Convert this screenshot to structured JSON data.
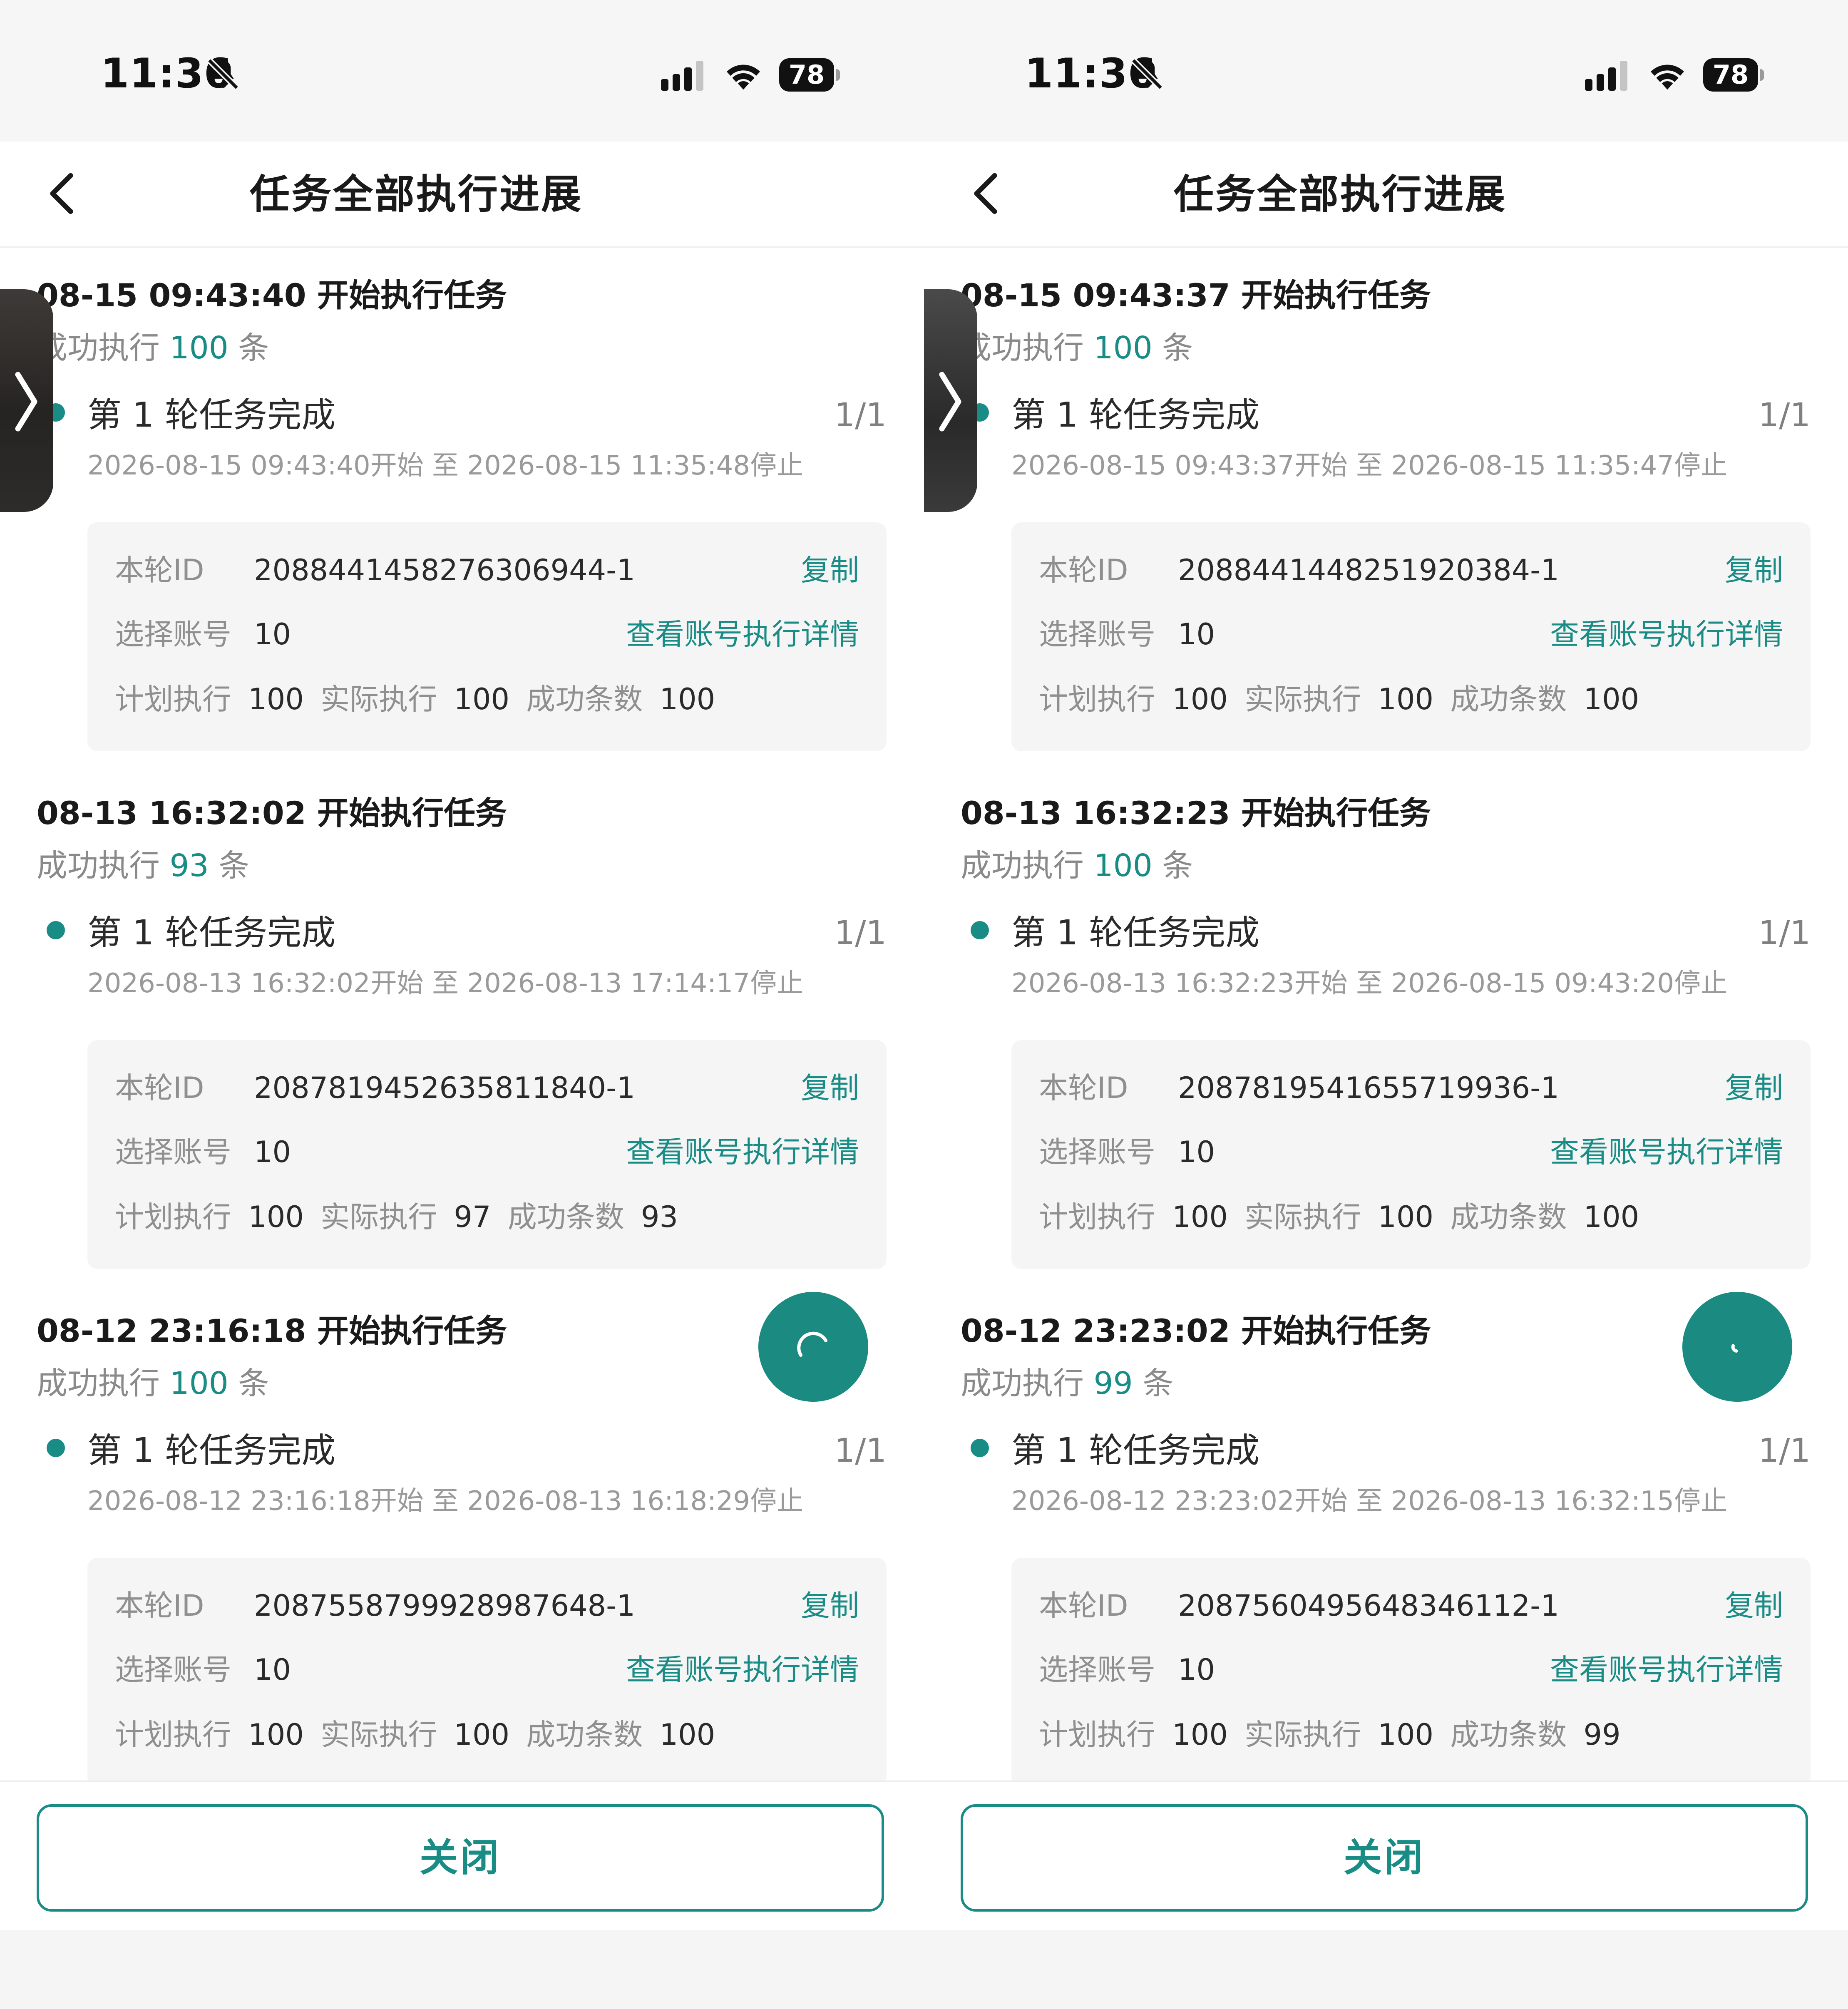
{
  "screens": [
    {
      "status": {
        "time": "11:36",
        "battery": "78"
      },
      "nav": {
        "title": "任务全部执行进展"
      },
      "groups": [
        {
          "title": "08-15 09:43:40 开始执行任务",
          "success_prefix": "成功执行",
          "success_count": "100",
          "success_suffix": "条",
          "round_title": "第 1 轮任务完成",
          "round_count": "1/1",
          "round_time": "2026-08-15 09:43:40开始 至 2026-08-15 11:35:48停止",
          "round_id_label": "本轮ID",
          "round_id": "2088441458276306944-1",
          "copy_label": "复制",
          "accounts_label": "选择账号",
          "accounts": "10",
          "detail_link": "查看账号执行详情",
          "planned_label": "计划执行",
          "planned": "100",
          "actual_label": "实际执行",
          "actual": "100",
          "success_label": "成功条数",
          "success": "100"
        },
        {
          "title": "08-13 16:32:02 开始执行任务",
          "success_prefix": "成功执行",
          "success_count": "93",
          "success_suffix": "条",
          "round_title": "第 1 轮任务完成",
          "round_count": "1/1",
          "round_time": "2026-08-13 16:32:02开始 至 2026-08-13 17:14:17停止",
          "round_id_label": "本轮ID",
          "round_id": "2087819452635811840-1",
          "copy_label": "复制",
          "accounts_label": "选择账号",
          "accounts": "10",
          "detail_link": "查看账号执行详情",
          "planned_label": "计划执行",
          "planned": "100",
          "actual_label": "实际执行",
          "actual": "97",
          "success_label": "成功条数",
          "success": "93"
        },
        {
          "title": "08-12 23:16:18 开始执行任务",
          "success_prefix": "成功执行",
          "success_count": "100",
          "success_suffix": "条",
          "round_title": "第 1 轮任务完成",
          "round_count": "1/1",
          "round_time": "2026-08-12 23:16:18开始 至 2026-08-13 16:18:29停止",
          "round_id_label": "本轮ID",
          "round_id": "2087558799928987648-1",
          "copy_label": "复制",
          "accounts_label": "选择账号",
          "accounts": "10",
          "detail_link": "查看账号执行详情",
          "planned_label": "计划执行",
          "planned": "100",
          "actual_label": "实际执行",
          "actual": "100",
          "success_label": "成功条数",
          "success": "100"
        }
      ],
      "close_label": "关闭"
    },
    {
      "status": {
        "time": "11:36",
        "battery": "78"
      },
      "nav": {
        "title": "任务全部执行进展"
      },
      "groups": [
        {
          "title": "08-15 09:43:37 开始执行任务",
          "success_prefix": "成功执行",
          "success_count": "100",
          "success_suffix": "条",
          "round_title": "第 1 轮任务完成",
          "round_count": "1/1",
          "round_time": "2026-08-15 09:43:37开始 至 2026-08-15 11:35:47停止",
          "round_id_label": "本轮ID",
          "round_id": "2088441448251920384-1",
          "copy_label": "复制",
          "accounts_label": "选择账号",
          "accounts": "10",
          "detail_link": "查看账号执行详情",
          "planned_label": "计划执行",
          "planned": "100",
          "actual_label": "实际执行",
          "actual": "100",
          "success_label": "成功条数",
          "success": "100"
        },
        {
          "title": "08-13 16:32:23 开始执行任务",
          "success_prefix": "成功执行",
          "success_count": "100",
          "success_suffix": "条",
          "round_title": "第 1 轮任务完成",
          "round_count": "1/1",
          "round_time": "2026-08-13 16:32:23开始 至 2026-08-15 09:43:20停止",
          "round_id_label": "本轮ID",
          "round_id": "2087819541655719936-1",
          "copy_label": "复制",
          "accounts_label": "选择账号",
          "accounts": "10",
          "detail_link": "查看账号执行详情",
          "planned_label": "计划执行",
          "planned": "100",
          "actual_label": "实际执行",
          "actual": "100",
          "success_label": "成功条数",
          "success": "100"
        },
        {
          "title": "08-12 23:23:02 开始执行任务",
          "success_prefix": "成功执行",
          "success_count": "99",
          "success_suffix": "条",
          "round_title": "第 1 轮任务完成",
          "round_count": "1/1",
          "round_time": "2026-08-12 23:23:02开始 至 2026-08-13 16:32:15停止",
          "round_id_label": "本轮ID",
          "round_id": "2087560495648346112-1",
          "copy_label": "复制",
          "accounts_label": "选择账号",
          "accounts": "10",
          "detail_link": "查看账号执行详情",
          "planned_label": "计划执行",
          "planned": "100",
          "actual_label": "实际执行",
          "actual": "100",
          "success_label": "成功条数",
          "success": "99"
        }
      ],
      "close_label": "关闭"
    }
  ],
  "colors": {
    "accent": "#1a8c86",
    "fab": "#1b8a80",
    "muted": "#8f8f8f"
  },
  "icons": [
    "back-arrow-icon",
    "bell-slash-icon",
    "signal-icon",
    "wifi-icon",
    "battery-icon",
    "chevron-right-icon",
    "loading-spinner-icon"
  ]
}
